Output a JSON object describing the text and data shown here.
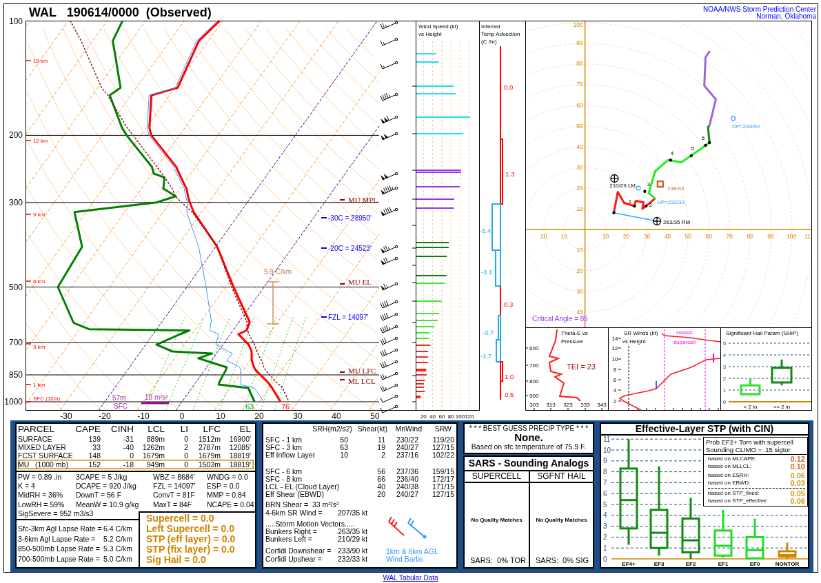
{
  "header": {
    "title": "WAL   190614/0000  (Observed)",
    "source": [
      "NOAA/NWS Storm Prediction Center",
      "Norman, Oklahoma"
    ]
  },
  "skew_t": {
    "pressure_labels": [
      "100",
      "200",
      "300",
      "500",
      "700",
      "850",
      "1000"
    ],
    "temperature_labels": [
      "-30",
      "-20",
      "-10",
      "0",
      "10",
      "20",
      "30",
      "40",
      "50"
    ],
    "height_labels": [
      "15 km",
      "12 km",
      "9 km",
      "6 km",
      "3 km",
      "1 km",
      "SFC (12m)"
    ],
    "annotations": [
      {
        "kind": "parcel_level",
        "text": "MU MPL"
      },
      {
        "kind": "isotherm",
        "text": "-30C = 28950'"
      },
      {
        "kind": "isotherm",
        "text": "-20C = 24523'"
      },
      {
        "kind": "lapse_rate",
        "text": "5.9 C/km"
      },
      {
        "kind": "parcel_level",
        "text": "MU EL"
      },
      {
        "kind": "isotherm",
        "text": "FZL = 14097'"
      },
      {
        "kind": "parcel_level",
        "text": "MU LFC"
      },
      {
        "kind": "parcel_level",
        "text": "ML LCL"
      }
    ],
    "inflow_layer": {
      "top": "57m",
      "bottom": "SFC",
      "srh": "10 m²s²"
    },
    "surface_dewpoint": "63",
    "surface_temperature": "76"
  },
  "wind_speed": {
    "title": [
      "Wind Speed (kt)",
      "vs Height"
    ],
    "ticks": [
      "20",
      "40",
      "60",
      "80",
      "100",
      "120"
    ]
  },
  "temp_advection": {
    "title": [
      "Inferred",
      "Temp Advection",
      "(C /hr)"
    ],
    "layers": [
      {
        "reading": "0.0",
        "color": "#ff0000"
      },
      {
        "reading": "1.3",
        "color": "#ff0000"
      },
      {
        "reading": "-5.4",
        "color": "#22aaee"
      },
      {
        "reading": "-2.1",
        "color": "#22aaee"
      },
      {
        "reading": "0.3",
        "color": "#ff0000"
      },
      {
        "reading": "-0.7",
        "color": "#22aaee"
      },
      {
        "reading": "-1.7",
        "color": "#22aaee"
      },
      {
        "reading": "1.0",
        "color": "#ff0000"
      },
      {
        "reading": "0.5",
        "color": "#ff0000"
      }
    ]
  },
  "hodograph": {
    "chart_data": {
      "type": "line",
      "x": [
        14,
        15.9,
        19,
        24,
        24.6,
        28.4,
        27.8,
        29.6,
        34,
        30.9,
        34,
        40.3,
        41.5,
        46.5,
        51.5,
        58.4,
        60.3,
        59.6,
        60.3,
        63.4,
        57.8,
        58.4,
        60.5
      ],
      "series": [
        {
          "color": "#ff1a1a",
          "values": [
            8.1,
            18.1,
            12.8,
            11.3,
            13.8,
            13.1,
            10,
            11.3,
            15,
            null,
            null,
            null,
            null,
            null,
            null,
            null,
            null,
            null,
            null,
            null,
            null,
            null,
            null
          ]
        },
        {
          "color": "#22ee22",
          "values": [
            null,
            null,
            null,
            null,
            null,
            null,
            null,
            null,
            15,
            17.5,
            28.1,
            33.5,
            33.4,
            32.3,
            35.6,
            40.6,
            41.9,
            null,
            null,
            null,
            null,
            null,
            null
          ]
        },
        {
          "color": "#118811",
          "values": [
            null,
            null,
            null,
            null,
            null,
            null,
            null,
            null,
            null,
            null,
            null,
            null,
            null,
            null,
            null,
            null,
            41.9,
            49.4,
            50,
            null,
            null,
            null,
            null
          ]
        },
        {
          "color": "#9966dd",
          "values": [
            null,
            null,
            null,
            null,
            null,
            null,
            null,
            null,
            null,
            null,
            null,
            null,
            null,
            null,
            null,
            null,
            null,
            null,
            50,
            62.8,
            69.4,
            83.1,
            86
          ]
        }
      ],
      "xlim": [
        -28.9,
        110
      ],
      "ylim": [
        -47.5,
        100.7
      ],
      "xticks": [
        {
          "value": -20,
          "label": "20"
        },
        {
          "value": -10,
          "label": "10"
        },
        10,
        20,
        30,
        40,
        50,
        60,
        70,
        80,
        90,
        100
      ],
      "yticks": [
        100,
        90,
        80,
        70,
        60,
        50,
        40,
        30,
        20,
        10,
        {
          "value": -10,
          "label": "10"
        },
        {
          "value": -20,
          "label": "20"
        },
        {
          "value": -30,
          "label": "30"
        },
        {
          "value": -40,
          "label": "40"
        }
      ]
    },
    "cut_tick_label": "11",
    "height_markers": [
      "1",
      "2",
      "3",
      "4",
      "5",
      "6"
    ],
    "storm_motions": [
      {
        "kind": "downshear",
        "label": "DP=233/90"
      },
      {
        "kind": "left_mover",
        "label": "210/29 LM"
      },
      {
        "kind": "mean_wind",
        "label": "238/43"
      },
      {
        "kind": "upshear",
        "label": "UP=232/33"
      },
      {
        "kind": "right_mover",
        "label": "263/35 RM"
      }
    ],
    "critical_angle": "Critical Angle = 85"
  },
  "theta_e": {
    "title": [
      "Theta-E vs",
      "Pressure"
    ],
    "pressure_labels": [
      "600",
      "700",
      "800",
      "900"
    ],
    "theta_labels": [
      "303",
      "313",
      "323",
      "333",
      "343"
    ],
    "tei": "TEI = 23"
  },
  "sr_winds": {
    "title": [
      "SR Winds (kt)",
      "vs Height"
    ],
    "height_labels": [
      "14",
      "12",
      "10",
      "8",
      "6",
      "4",
      "2"
    ],
    "band_label": [
      "classic",
      "supercell"
    ]
  },
  "ship": {
    "title": "Significant Hail Param (SHIP)",
    "y_labels": [
      "5",
      "4",
      "3",
      "2",
      "1",
      "0"
    ],
    "categories": [
      {
        "label": "< 2 in",
        "color": "#33dd33"
      },
      {
        "label": ">= 2 in",
        "color": "#118811"
      }
    ]
  },
  "parcels": {
    "columns": [
      "PARCEL",
      "CAPE",
      "CINH",
      "LCL",
      "LI",
      "LFC",
      "EL"
    ],
    "rows": [
      {
        "name": "SURFACE",
        "values": [
          "139",
          "-31",
          "889m",
          "0",
          "1512m",
          "16900'"
        ],
        "highlighted": false
      },
      {
        "name": "MIXED LAYER",
        "values": [
          "33",
          "-40",
          "1262m",
          "2",
          "2787m",
          "12085'"
        ],
        "highlighted": false
      },
      {
        "name": "FCST SURFACE",
        "values": [
          "148",
          "0",
          "1679m",
          "0",
          "1679m",
          "18819'"
        ],
        "highlighted": false
      },
      {
        "name": "MU   (1000 mb)",
        "values": [
          "152",
          "-18",
          "949m",
          "0",
          "1503m",
          "18819'"
        ],
        "highlighted": true
      }
    ]
  },
  "indices": {
    "rows": [
      [
        "PW = 0.89 .in",
        "3CAPE = 5 J/kg",
        "WBZ = 8684'",
        "WNDG = 0.0"
      ],
      [
        "K = 4",
        "DCAPE = 920 J/kg",
        "FZL = 14097'",
        "ESP = 0.0"
      ],
      [
        "MidRH = 36%",
        "DownT = 56 F",
        "ConvT = 81F",
        "MMP = 0.84"
      ],
      [
        "LowRH = 59%",
        "MeanW = 10.9 g/kg",
        "MaxT = 84F",
        "NCAPE = 0.04"
      ]
    ],
    "sig_severe": "SigSevere = 952 m3/s3"
  },
  "lapse_rates": [
    {
      "label": "Sfc-3km Agl Lapse Rate =",
      "value": "6.4 C/km"
    },
    {
      "label": "3-6km Agl Lapse Rate =",
      "value": "5.2 C/km"
    },
    {
      "label": "850-500mb Lapse Rate =",
      "value": "5.3 C/km"
    },
    {
      "label": "700-500mb Lapse Rate =",
      "value": "5.0 C/km"
    }
  ],
  "composite_parameters": [
    "Supercell = 0.0",
    "Left Supercell = 0.0",
    "STP (eff layer) = 0.0",
    "STP (fix layer) = 0.0",
    "Sig Hail = 0.0"
  ],
  "kinematics": {
    "columns": [
      "SRH(m2/s2)",
      "Shear(kt)",
      "MnWind",
      "SRW"
    ],
    "groups": [
      [
        {
          "layer": "SFC - 1 km",
          "srh": "50",
          "shear": "11",
          "mean_wind": "230/22",
          "srw": "119/20"
        },
        {
          "layer": "SFC - 3 km",
          "srh": "63",
          "shear": "19",
          "mean_wind": "240/27",
          "srw": "127/15"
        },
        {
          "layer": "Eff Inflow Layer",
          "srh": "10",
          "shear": "2",
          "mean_wind": "237/16",
          "srw": "102/22"
        }
      ],
      [
        {
          "layer": "SFC - 6 km",
          "shear": "56",
          "mean_wind": "237/36",
          "srw": "159/15"
        },
        {
          "layer": "SFC - 8 km",
          "shear": "66",
          "mean_wind": "236/40",
          "srw": "172/17"
        },
        {
          "layer": "LCL - EL (Cloud Layer)",
          "shear": "40",
          "mean_wind": "240/38",
          "srw": "171/15"
        },
        {
          "layer": "Eff Shear (EBWD)",
          "shear": "20",
          "mean_wind": "240/27",
          "srw": "127/15"
        }
      ]
    ],
    "brn_shear": "BRN Shear =  33 m²/s²",
    "sr_wind": {
      "label": "4-6km SR Wind =",
      "value": "207/35 kt"
    },
    "storm_motion_title": ".....Storm Motion Vectors.....",
    "storm_motions": [
      {
        "label": "Bunkers Right =",
        "value": "263/35 kt"
      },
      {
        "label": "Bunkers Left =",
        "value": "210/29 kt"
      }
    ],
    "corfidi": [
      {
        "label": "Corfidi Downshear =",
        "value": "233/90 kt"
      },
      {
        "label": "Corfidi Upshear =",
        "value": "232/33 kt"
      }
    ],
    "barb_caption": [
      "1km & 6km AGL",
      "Wind Barbs"
    ]
  },
  "precip": {
    "title": "* * * BEST GUESS PRECIP TYPE * * *",
    "type": "None.",
    "note": "Based on sfc temperature of 75.9 F."
  },
  "sars": {
    "title": "SARS - Sounding Analogs",
    "columns": [
      {
        "heading": "SUPERCELL",
        "matches": "No Quality Matches",
        "summary": "SARS:  0% TOR"
      },
      {
        "heading": "SGFNT HAIL",
        "matches": "No Quality Matches",
        "summary": "SARS:  0% SIG"
      }
    ]
  },
  "stp": {
    "title": "Effective-Layer STP (with CIN)",
    "y_labels": [
      "11",
      "10",
      "9",
      "8",
      "7",
      "6",
      "5",
      "4",
      "3",
      "2",
      "1",
      "0"
    ],
    "categories": [
      {
        "label": "EF4+",
        "color": "#108a10"
      },
      {
        "label": "EF3",
        "color": "#108a10"
      },
      {
        "label": "EF2",
        "color": "#108a10"
      },
      {
        "label": "EF1",
        "color": "#22dd22"
      },
      {
        "label": "EF0",
        "color": "#22dd22"
      },
      {
        "label": "NONTOR",
        "color": "#cc8800"
      }
    ],
    "probabilities": {
      "title": [
        "Prob EF2+ Torn with supercell",
        "Sounding CLIMO = .15 sigtor"
      ],
      "rows": [
        {
          "label": "based on MLCAPE:",
          "value": "0.12",
          "color": "#e0622a"
        },
        {
          "label": "based on MLLCL:",
          "value": "0.10",
          "color": "#e0622a"
        },
        {
          "label": "based on ESRH:",
          "value": "0.06",
          "color": "#d99a1a"
        },
        {
          "label": "based on EBWD:",
          "value": "0.03",
          "color": "#d99a1a"
        },
        {
          "label": "based on STP_fixed:",
          "value": "0.05",
          "color": "#d99a1a"
        },
        {
          "label": "based on STP_effective:",
          "value": "0.06",
          "color": "#d99a1a"
        }
      ]
    }
  },
  "footer": {
    "link": "WAL Tabular Data"
  }
}
